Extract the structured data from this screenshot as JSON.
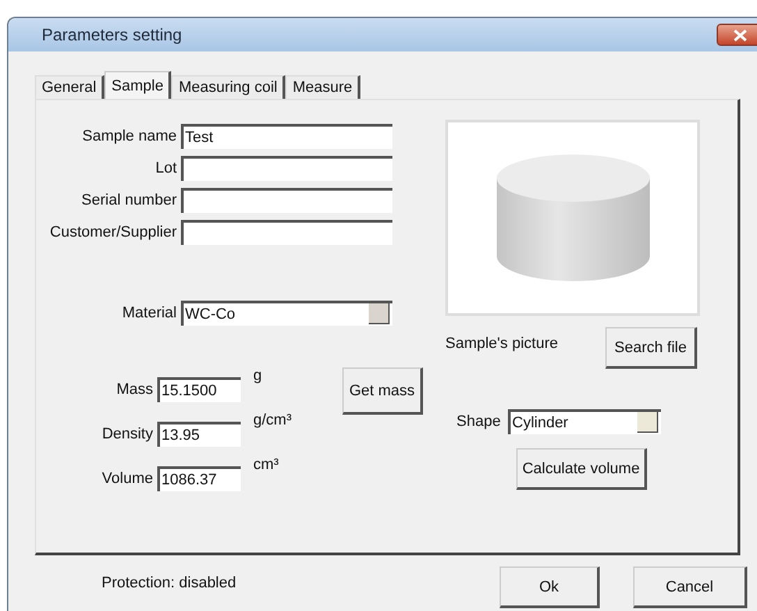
{
  "window": {
    "title": "Parameters setting"
  },
  "tabs": [
    {
      "label": "General",
      "selected": false
    },
    {
      "label": "Sample",
      "selected": true
    },
    {
      "label": "Measuring coil",
      "selected": false
    },
    {
      "label": "Measure",
      "selected": false
    }
  ],
  "sample_fields": [
    {
      "label": "Sample name",
      "value": "Test"
    },
    {
      "label": "Lot"
    },
    {
      "label": "Serial number"
    },
    {
      "label": "Customer/Supplier"
    }
  ],
  "material": {
    "label": "Material",
    "value": "WC-Co"
  },
  "measures": [
    {
      "label": "Mass",
      "value": "15.1500",
      "unit": "g"
    },
    {
      "label": "Density",
      "value": "13.95",
      "unit": "g/cm³"
    },
    {
      "label": "Volume",
      "value": "1086.37",
      "unit": "cm³"
    }
  ],
  "get_mass_button": "Get mass",
  "picture": {
    "caption": "Sample's picture",
    "button": "Search file"
  },
  "shape": {
    "label": "Shape",
    "value": "Cylinder"
  },
  "calculate_button": "Calculate volume",
  "status": "Protection: disabled",
  "buttons": [
    "Ok",
    "Cancel"
  ]
}
